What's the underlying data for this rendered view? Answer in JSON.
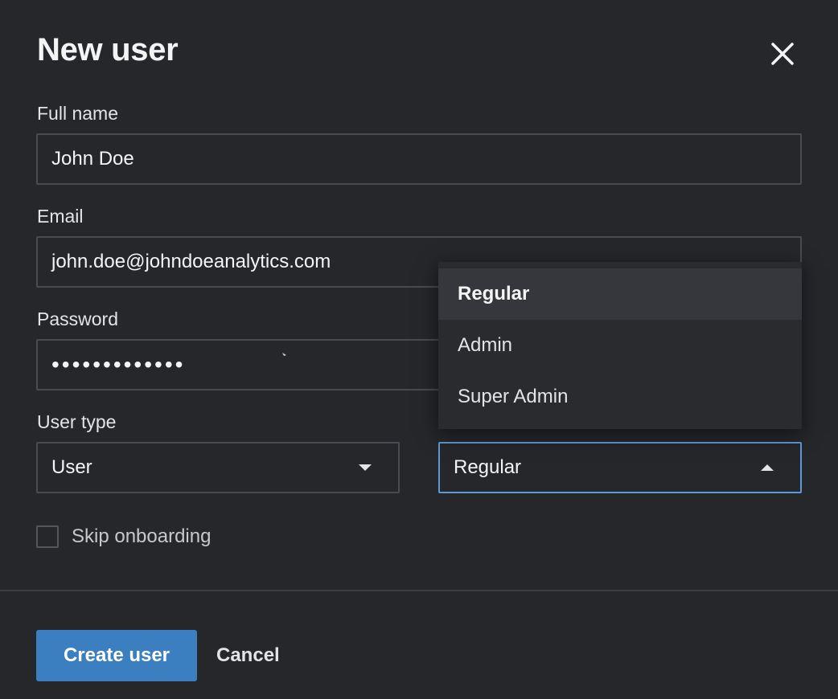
{
  "dialog": {
    "title": "New user",
    "close_icon": "close-icon"
  },
  "form": {
    "full_name": {
      "label": "Full name",
      "value": "John Doe"
    },
    "email": {
      "label": "Email",
      "value": "john.doe@johndoeanalytics.com"
    },
    "password": {
      "label": "Password",
      "value": "•••••••••••••"
    },
    "user_type": {
      "label": "User type",
      "value": "User"
    },
    "role": {
      "value": "Regular",
      "options": [
        "Regular",
        "Admin",
        "Super Admin"
      ],
      "selected": "Regular"
    },
    "skip_onboarding": {
      "label": "Skip onboarding",
      "checked": false
    }
  },
  "actions": {
    "primary_label": "Create user",
    "cancel_label": "Cancel"
  },
  "colors": {
    "background": "#26272b",
    "accent": "#3c7fc0",
    "focus_border": "#5b9bd5"
  }
}
